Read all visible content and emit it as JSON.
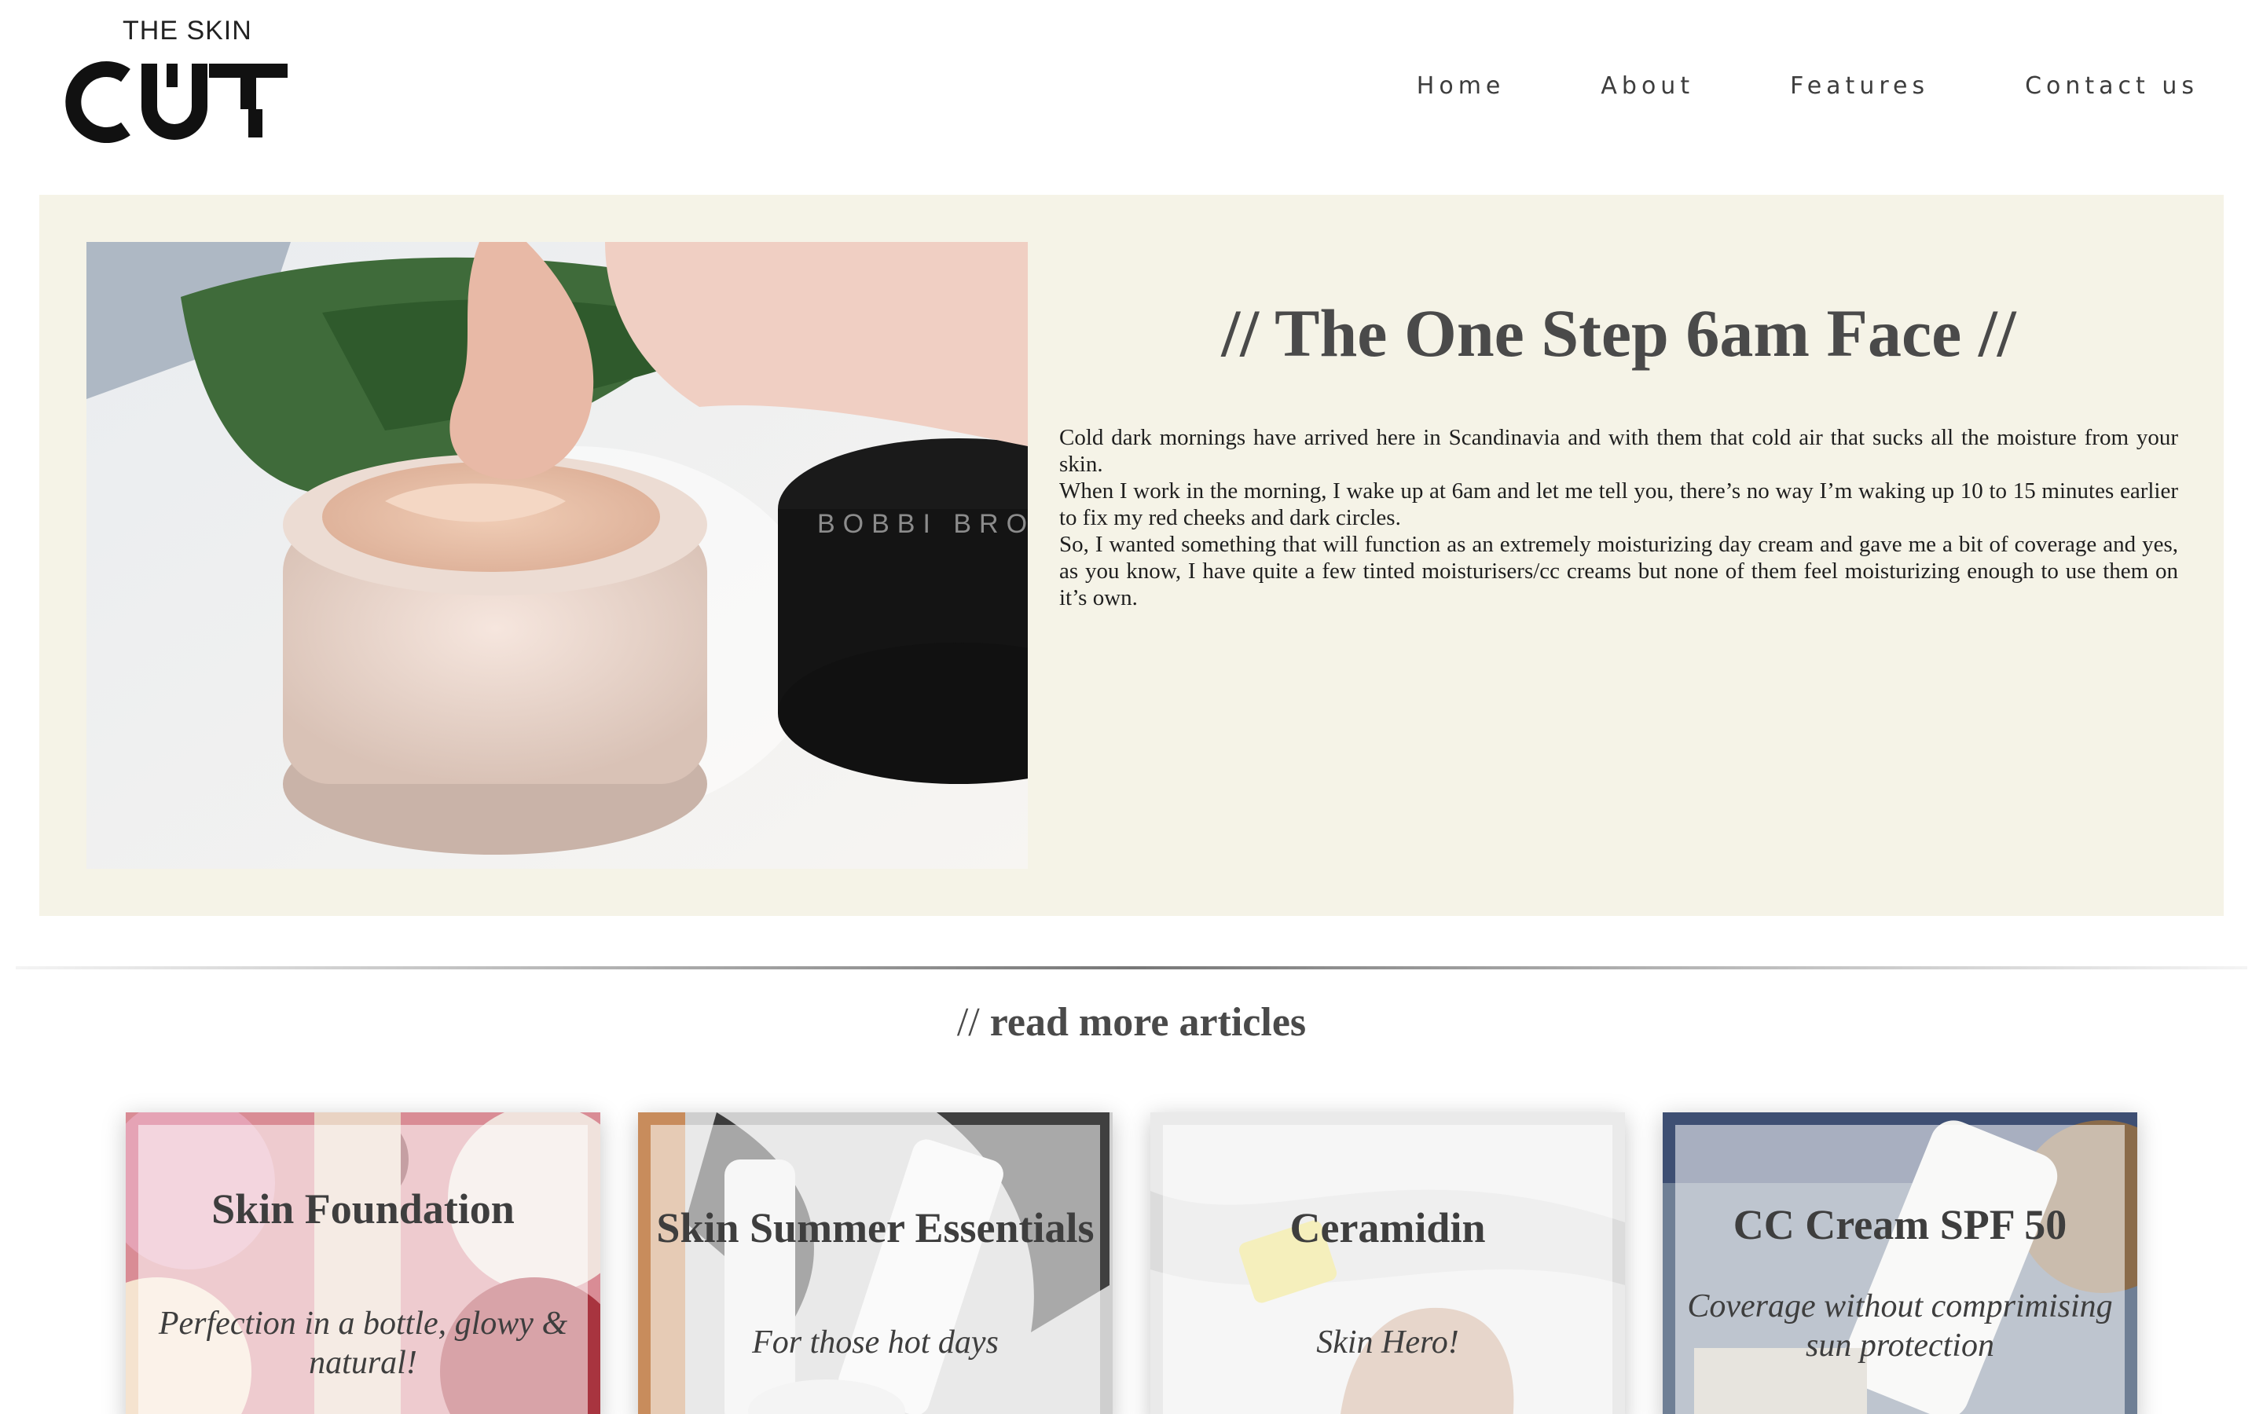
{
  "brand": {
    "top": "THE SKIN",
    "main": "CUT"
  },
  "nav": [
    {
      "label": "Home"
    },
    {
      "label": "About"
    },
    {
      "label": "Features"
    },
    {
      "label": "Contact us"
    }
  ],
  "hero": {
    "title": "// The One Step 6am Face //",
    "paragraphs": [
      "Cold dark mornings have arrived here in Scandinavia and with them that cold air that sucks all the moisture from your skin.",
      "When I work in the morning, I wake up at 6am and let me tell you, there’s no way I’m waking up 10 to 15 minutes earlier to fix my red cheeks and dark circles.",
      "So, I wanted something that will function as an extremely moisturizing day cream and gave me a bit of coverage and yes, as you know, I have quite a few tinted moisturisers/cc creams but none of them feel moisturizing enough to use them on it’s own."
    ],
    "image_label": "BOBBI BRO"
  },
  "section": {
    "slashes": "//",
    "title": "read more articles"
  },
  "cards": [
    {
      "title": "Skin Foundation",
      "subtitle": "Perfection in a bottle, glowy & natural!"
    },
    {
      "title": "Skin Summer Essentials",
      "subtitle": "For those hot days"
    },
    {
      "title": "Ceramidin",
      "subtitle": "Skin Hero!"
    },
    {
      "title": "CC Cream SPF 50",
      "subtitle": "Coverage without comprimising sun protection"
    }
  ],
  "colors": {
    "hero_bg": "#f5f3e7",
    "text": "#4a4a4a",
    "body_text": "#1f1f1f"
  }
}
